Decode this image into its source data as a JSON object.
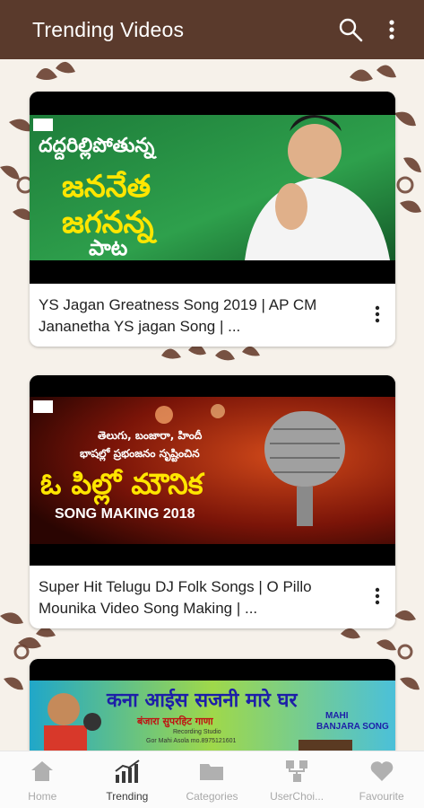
{
  "app": {
    "title": "Trending Videos",
    "accent_color": "#5a3a2c"
  },
  "toolbar": {
    "search_icon": "search-icon",
    "menu_icon": "more-vertical-icon"
  },
  "videos": [
    {
      "title": "YS Jagan Greatness Song 2019 | AP CM Jananetha YS jagan Song | ...",
      "thumb_text": [
        "దద్దరిల్లిపోతున్న",
        "జననేత",
        "జగనన్న",
        "పాట"
      ]
    },
    {
      "title": "Super Hit Telugu DJ Folk Songs | O Pillo Mounika Video Song Making | ...",
      "thumb_text": [
        "తెలుగు, బంజారా, హిందీ",
        "భాషల్లో ప్రభంజనం సృష్టించిన",
        "ఓ పిల్లో మౌనిక",
        "SONG MAKING 2018"
      ]
    },
    {
      "title": "",
      "thumb_text": [
        "कना आईस सजनी मारे घर",
        "बंजारा सुपरहिट गाणा",
        "MAHI",
        "BANJARA SONG",
        "Recording Studio",
        "Gor Mahi Asola mo.8975121601"
      ]
    }
  ],
  "bottom_nav": [
    {
      "label": "Home",
      "icon": "home-icon",
      "active": false
    },
    {
      "label": "Trending",
      "icon": "trending-chart-icon",
      "active": true
    },
    {
      "label": "Categories",
      "icon": "folder-icon",
      "active": false
    },
    {
      "label": "UserChoi...",
      "icon": "user-choice-icon",
      "active": false
    },
    {
      "label": "Favourite",
      "icon": "heart-icon",
      "active": false
    }
  ]
}
